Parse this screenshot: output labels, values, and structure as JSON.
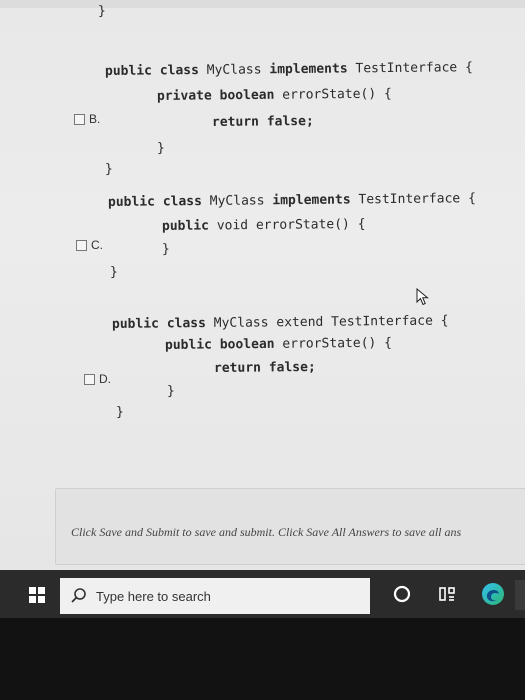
{
  "code": {
    "b_prev_brace": "}",
    "b_line1_kw1": "public class",
    "b_line1_name": " MyClass ",
    "b_line1_kw2": "implements",
    "b_line1_rest": " TestInterface {",
    "b_line2_kw": "private boolean",
    "b_line2_rest": " errorState() {",
    "b_line3": "return false;",
    "b_line4": "}",
    "b_line5": "}",
    "c_line1_kw1": "public class",
    "c_line1_name": " MyClass ",
    "c_line1_kw2": "implements",
    "c_line1_rest": " TestInterface {",
    "c_line2_kw": "public",
    "c_line2_rest": " void errorState() {",
    "c_line3": "}",
    "c_line4": "}",
    "d_line1_kw1": "public class",
    "d_line1_name": " MyClass extend TestInterface {",
    "d_line2_kw": "public boolean",
    "d_line2_rest": " errorState() {",
    "d_line3": "return false;",
    "d_line4": "}",
    "d_line5": "}"
  },
  "options": {
    "b": "B.",
    "c": "C.",
    "d": "D."
  },
  "footer": {
    "instructions": "Click Save and Submit to save and submit. Click Save All Answers to save all ans"
  },
  "taskbar": {
    "search_placeholder": "Type here to search"
  },
  "icons": {
    "start": "windows-logo-icon",
    "search": "search-icon",
    "cortana": "cortana-ring-icon",
    "task_view": "task-view-icon",
    "edge": "edge-browser-icon",
    "cursor": "mouse-pointer-icon"
  }
}
